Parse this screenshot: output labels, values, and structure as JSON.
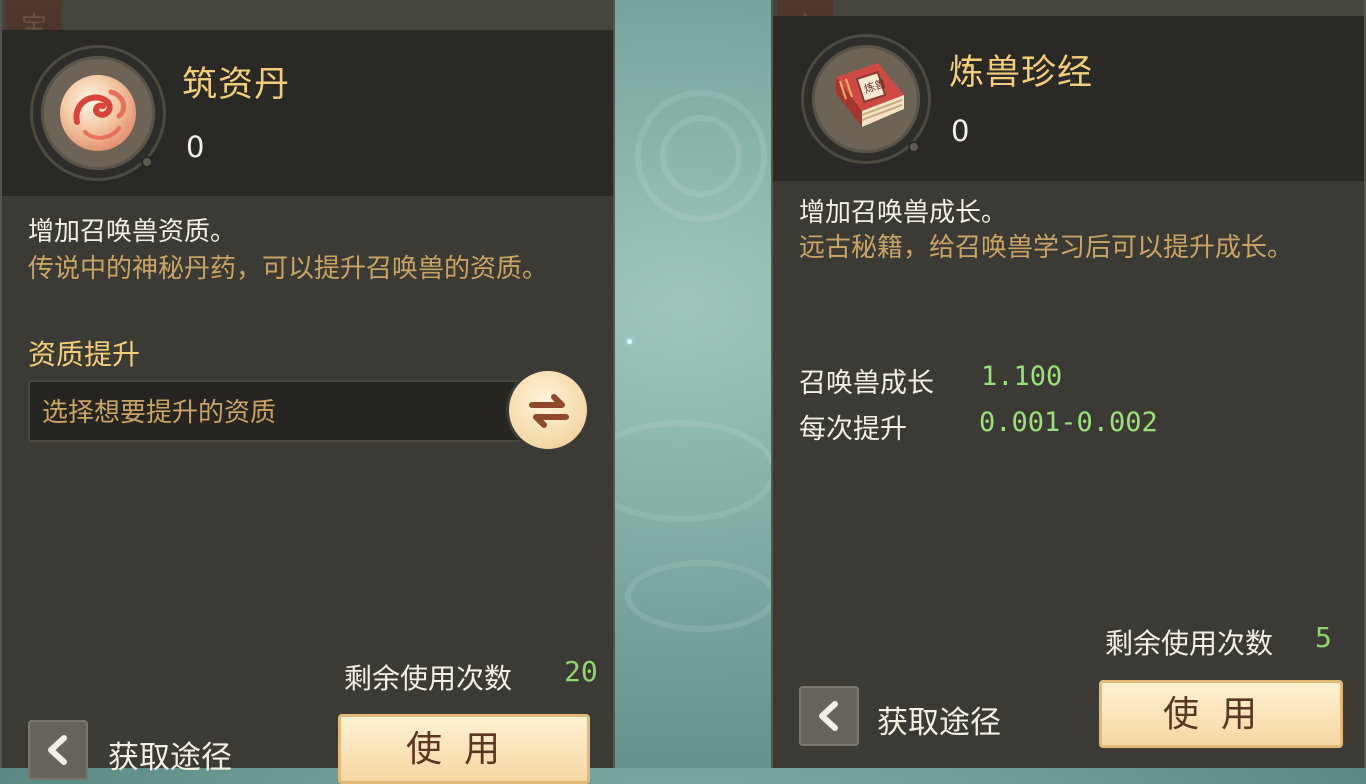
{
  "left_panel": {
    "corner_glyph": "宝",
    "item_icon": "pill-orb-icon",
    "title": "筑资丹",
    "count": "0",
    "description": "增加召唤兽资质。",
    "lore": "传说中的神秘丹药，可以提升召唤兽的资质。",
    "section_title": "资质提升",
    "select_placeholder": "选择想要提升的资质",
    "swap_icon": "swap-arrows-icon",
    "remaining_label": "剩余使用次数",
    "remaining_value": "20",
    "source_label": "获取途径",
    "use_label": "使用"
  },
  "right_panel": {
    "corner_glyph": "宝",
    "item_icon": "red-book-icon",
    "book_label": "炼兽",
    "title": "炼兽珍经",
    "count": "0",
    "description": "增加召唤兽成长。",
    "lore": "远古秘籍，给召唤兽学习后可以提升成长。",
    "stats": [
      {
        "label": "召唤兽成长",
        "value": "1.100"
      },
      {
        "label": "每次提升",
        "value": "0.001-0.002"
      }
    ],
    "remaining_label": "剩余使用次数",
    "remaining_value": "5",
    "source_label": "获取途径",
    "use_label": "使用"
  },
  "colors": {
    "panel_bg": "#3b3a34",
    "header_bg": "#2a2925",
    "title_gold": "#f1cf7a",
    "lore_tan": "#c9a465",
    "value_green": "#9be07a",
    "button_cream": "#f6d7a3"
  }
}
